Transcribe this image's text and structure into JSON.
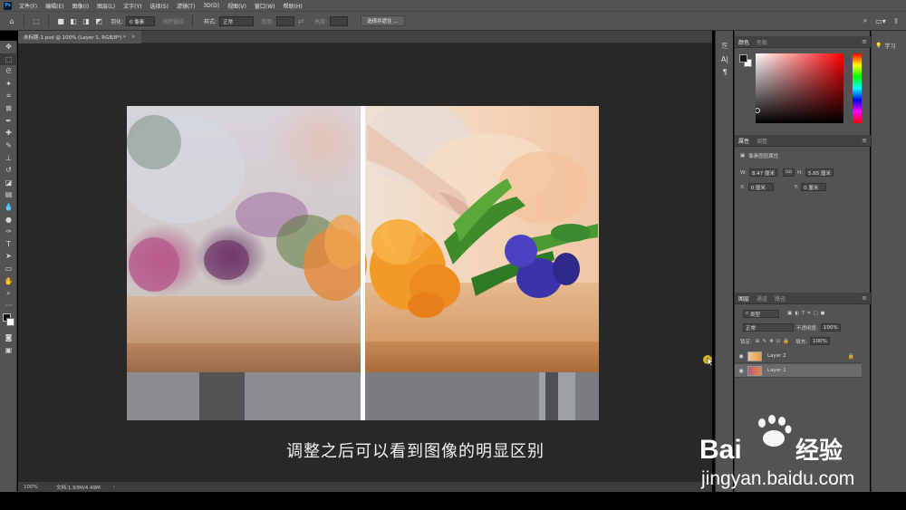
{
  "menubar": {
    "logo": "Ps",
    "items": [
      "文件(F)",
      "编辑(E)",
      "图像(I)",
      "图层(L)",
      "文字(Y)",
      "选择(S)",
      "滤镜(T)",
      "3D(D)",
      "视图(V)",
      "窗口(W)",
      "帮助(H)"
    ]
  },
  "options": {
    "feather_label": "羽化:",
    "feather_value": "0 像素",
    "antialias_label": "消除锯齿",
    "style_label": "样式:",
    "style_value": "正常",
    "width_label": "宽度:",
    "height_label": "高度:",
    "select_mask_button": "选择并遮住 ..."
  },
  "document": {
    "tab_title": "未标题-1.psd @ 100% (Layer 1, RGB/8*) *",
    "close_glyph": "×",
    "subtitle": "调整之后可以看到图像的明显区别"
  },
  "statusbar": {
    "zoom": "100%",
    "doc_size": "文档:1.93M/4.49M",
    "arrow": "›"
  },
  "color_panel": {
    "tabs": [
      "颜色",
      "色板"
    ],
    "menu_glyph": "≡"
  },
  "properties_panel": {
    "tabs": [
      "属性",
      "调整"
    ],
    "section_title": "像素图层属性",
    "w_label": "W:",
    "w_value": "8.47 厘米",
    "link_glyph": "GO",
    "h_label": "H:",
    "h_value": "5.65 厘米",
    "x_label": "X:",
    "x_value": "0 厘米",
    "y_label": "Y:",
    "y_value": "0 厘米"
  },
  "layers_panel": {
    "tabs": [
      "图层",
      "通道",
      "路径"
    ],
    "filter_kind": "类型",
    "blend_mode": "正常",
    "opacity_label": "不透明度:",
    "opacity_value": "100%",
    "lock_label": "锁定:",
    "fill_label": "填充:",
    "fill_value": "100%",
    "layers": [
      {
        "name": "Layer 2",
        "locked": true,
        "selected": false
      },
      {
        "name": "Layer 1",
        "locked": false,
        "selected": true
      }
    ]
  },
  "learn_panel": {
    "label": "学习"
  },
  "watermark": {
    "brand_left": "Bai",
    "brand_right": "经验",
    "url": "jingyan.baidu.com"
  },
  "colors": {
    "ui_dark": "#535353",
    "canvas_bg": "#282828",
    "panel_header": "#424242",
    "wood": "#c8956a"
  }
}
